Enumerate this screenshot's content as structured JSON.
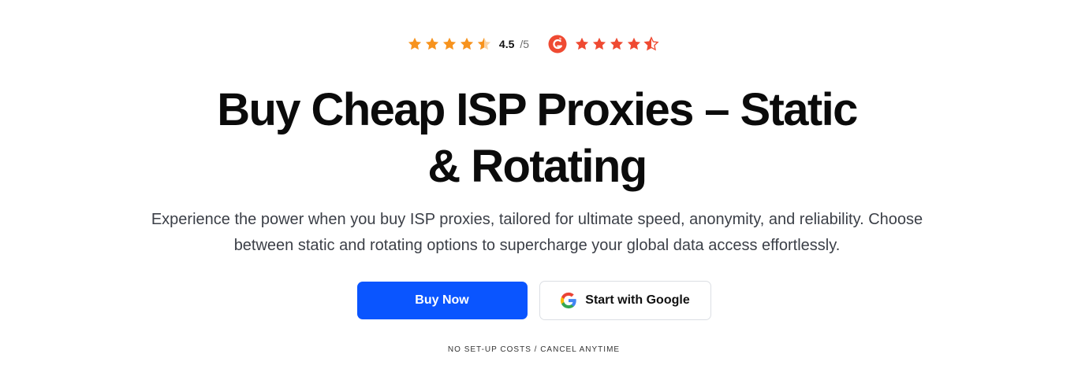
{
  "rating": {
    "score": "4.5",
    "max": "/5",
    "star_color": "#f7931e",
    "g2_color": "#ef4a32",
    "trustpilot_like_stars": 4.5,
    "g2_stars": 4.5
  },
  "hero": {
    "title": "Buy Cheap ISP Proxies – Static & Rotating",
    "subtitle": "Experience the power when you buy ISP proxies, tailored for ultimate speed, anonymity, and reliability. Choose between static and rotating options to supercharge your global data access effortlessly."
  },
  "actions": {
    "buy_label": "Buy Now",
    "google_label": "Start with Google",
    "primary_color": "#0a55ff"
  },
  "footnote": "NO SET-UP COSTS / CANCEL ANYTIME"
}
